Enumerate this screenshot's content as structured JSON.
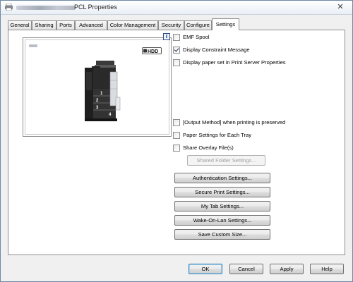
{
  "window": {
    "title": "PCL Properties",
    "close_glyph": "✕"
  },
  "tabs": [
    {
      "label": "General"
    },
    {
      "label": "Sharing"
    },
    {
      "label": "Ports"
    },
    {
      "label": "Advanced"
    },
    {
      "label": "Color Management"
    },
    {
      "label": "Security"
    },
    {
      "label": "Configure"
    },
    {
      "label": "Settings",
      "active": true
    }
  ],
  "preview": {
    "hdd_label": "HDD",
    "tray_numbers": [
      "1",
      "2",
      "3",
      "4"
    ],
    "info_glyph": "i"
  },
  "checkboxes": {
    "emf_spool": {
      "label": "EMF Spool",
      "checked": false
    },
    "display_constraint": {
      "label": "Display Constraint Message",
      "checked": true
    },
    "display_paper_set": {
      "label": "Display paper set in Print Server Properties",
      "checked": false
    },
    "output_method": {
      "label": "[Output Method] when printing is preserved",
      "checked": false
    },
    "paper_settings_tray": {
      "label": "Paper Settings for Each Tray",
      "checked": false
    },
    "share_overlay": {
      "label": "Share Overlay File(s)",
      "checked": false
    }
  },
  "buttons": {
    "shared_folder": "Shared Folder Settings...",
    "authentication": "Authentication Settings...",
    "secure_print": "Secure Print Settings...",
    "my_tab": "My Tab Settings...",
    "wake_on_lan": "Wake-On-Lan Settings...",
    "save_custom_size": "Save Custom Size...",
    "ok": "OK",
    "cancel": "Cancel",
    "apply": "Apply",
    "help": "Help"
  }
}
